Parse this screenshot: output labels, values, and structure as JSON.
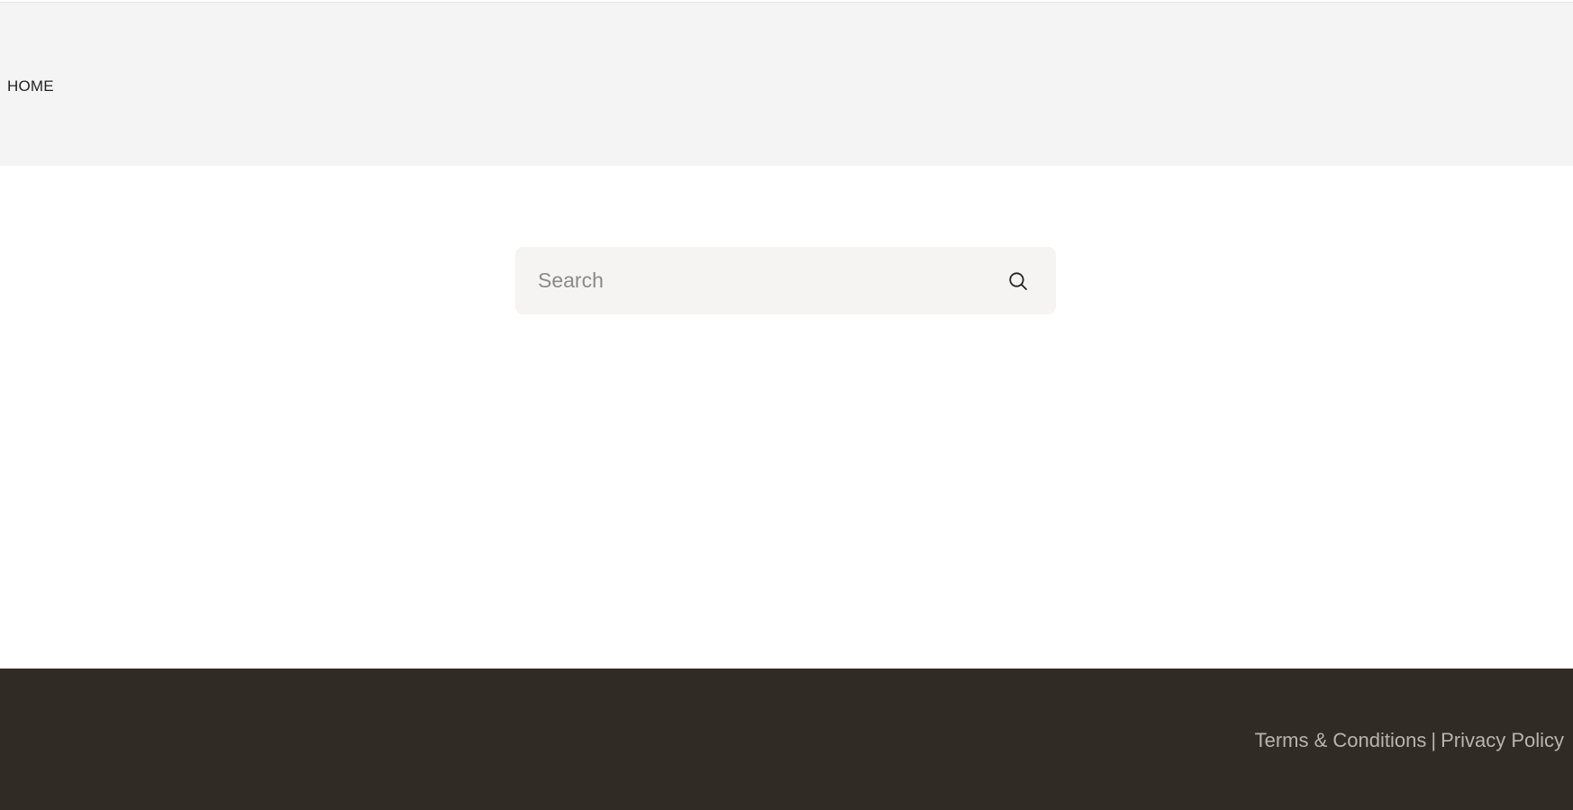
{
  "header": {
    "nav": {
      "home_label": "HOME"
    }
  },
  "search": {
    "placeholder": "Search",
    "value": "",
    "icon": "search-icon"
  },
  "footer": {
    "terms_label": "Terms & Conditions",
    "separator": "|",
    "privacy_label": "Privacy Policy"
  },
  "colors": {
    "header_bg": "#f4f4f4",
    "search_bg": "#f5f4f2",
    "footer_bg": "#312b25",
    "footer_text": "#b8b4ae",
    "nav_text": "#222222"
  }
}
